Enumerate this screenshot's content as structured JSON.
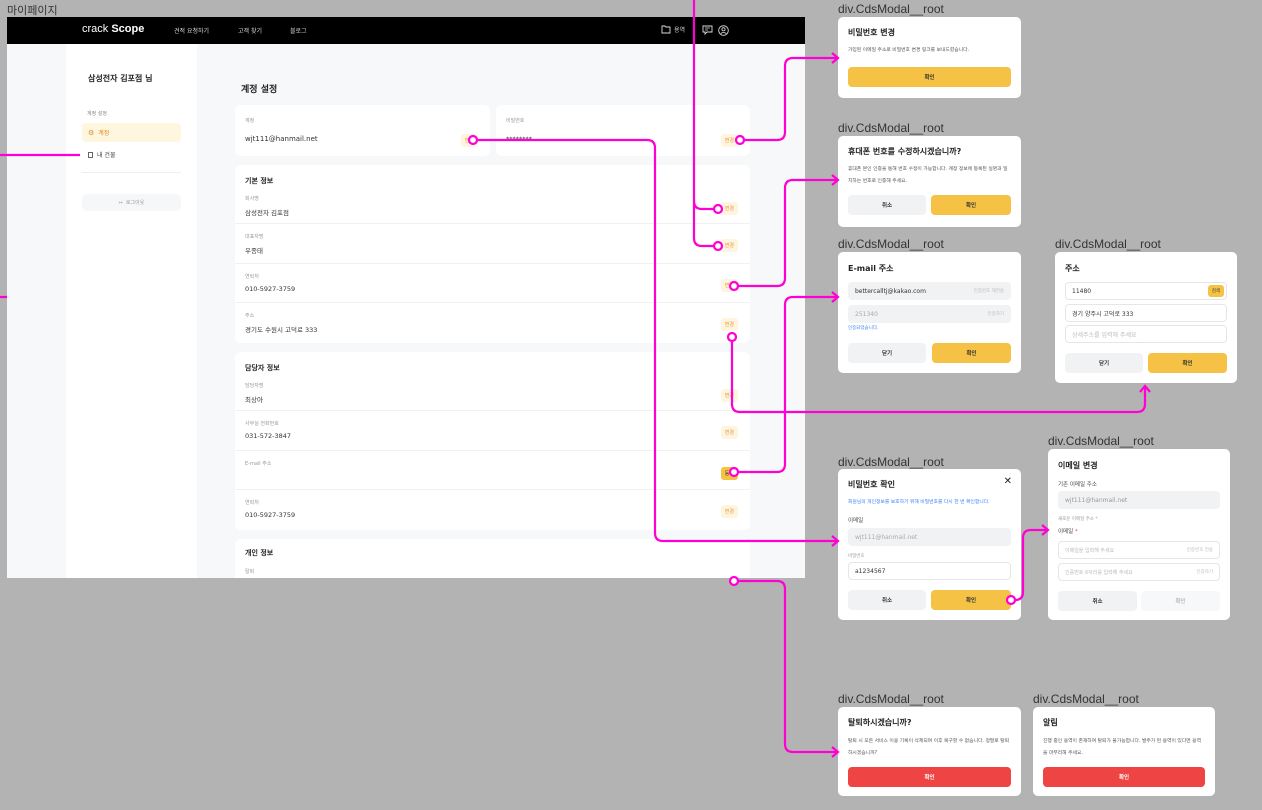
{
  "canvas": {
    "frame_label": "마이페이지",
    "modal_label": "div.CdsModal__root",
    "connector_color": "#ff00d4"
  },
  "header": {
    "logo_light": "crack ",
    "logo_bold": "Scope",
    "nav": [
      "견적 요청하기",
      "고객 찾기",
      "블로그"
    ],
    "orders": "용역",
    "icons": [
      "folder-icon",
      "chat-icon",
      "user-icon"
    ]
  },
  "sidebar": {
    "user": "삼성전자 김포점 님",
    "section": "계정 설정",
    "items": [
      {
        "label": "계정",
        "icon": "gear-icon",
        "active": true
      },
      {
        "label": "내 건물",
        "icon": "building-icon",
        "active": false
      }
    ],
    "logout": "로그아웃"
  },
  "main": {
    "title": "계정 설정",
    "account": {
      "label": "계정",
      "value": "wjt111@hanmail.net",
      "button": "변경"
    },
    "password": {
      "label": "비밀번호",
      "value": "********",
      "button": "변경"
    },
    "basic": {
      "title": "기본 정보",
      "rows": [
        {
          "label": "회사명",
          "value": "삼성전자 김포점",
          "button": "변경"
        },
        {
          "label": "대표자명",
          "value": "우종태",
          "button": "변경"
        },
        {
          "label": "연락처",
          "value": "010-5927-3759",
          "button": "변경"
        },
        {
          "label": "주소",
          "value": "경기도 수원시 고덕로 333",
          "button": "변경"
        }
      ]
    },
    "manager": {
      "title": "담당자 정보",
      "rows": [
        {
          "label": "담당자명",
          "value": "최상아",
          "button": "변경"
        },
        {
          "label": "사무실 전화번호",
          "value": "031-572-3847",
          "button": "변경"
        },
        {
          "label": "E-mail 주소",
          "value": "",
          "button": "등록"
        },
        {
          "label": "연락처",
          "value": "010-5927-3759",
          "button": "변경"
        }
      ]
    },
    "personal": {
      "title": "개인 정보",
      "rows": [
        {
          "label": "탈퇴"
        }
      ]
    }
  },
  "modals": {
    "pw_change": {
      "title": "비밀번호 변경",
      "text": "가입된 이메일 주소로 비밀번호 변경 링크를 보내드렸습니다.",
      "confirm": "확인"
    },
    "phone": {
      "title": "휴대폰 번호를 수정하시겠습니까?",
      "text": "휴대폰 본인 인증을 통해 번호 수정이 가능합니다. 계정 정보에 등록된 실명과 일치하는 번호로 인증해 주세요.",
      "cancel": "취소",
      "confirm": "확인"
    },
    "email": {
      "title": "E-mail 주소",
      "email_value": "bettercalltj@kakao.com",
      "send_label": "인증번호 재전송",
      "code_value": "251340",
      "verify_label": "인증하기",
      "verified": "인증되었습니다.",
      "close": "닫기",
      "confirm": "확인"
    },
    "address": {
      "title": "주소",
      "zip": "11480",
      "search": "검색",
      "address": "경기 양주시 고덕로 333",
      "detail_placeholder": "상세주소를 입력해 주세요",
      "close": "닫기",
      "confirm": "확인"
    },
    "pw_check": {
      "title": "비밀번호 확인",
      "text": "회원님의 개인정보를 보호하기 위해 비밀번호를 다시 한 번 확인합니다.",
      "email_label": "이메일",
      "email_value": "wjt111@hanmail.net",
      "pw_label": "비밀번호",
      "pw_value": "a1234567",
      "cancel": "취소",
      "confirm": "확인"
    },
    "email_change": {
      "title": "이메일 변경",
      "current_label": "기존 이메일 주소",
      "current_value": "wjt111@hanmail.net",
      "new_label": "새로운 이메일 주소 *",
      "email_label": "이메일",
      "required": "*",
      "email_placeholder": "이메일을 입력해 주세요",
      "send_label": "인증번호 전송",
      "code_placeholder": "인증번호 6자리를 입력해 주세요",
      "verify_label": "인증하기",
      "cancel": "취소",
      "confirm": "확인"
    },
    "withdraw": {
      "title": "탈퇴하시겠습니까?",
      "text": "탈퇴 시 모든 서비스 이용 기록이 삭제되며 이후 복구할 수 없습니다. 정말로 탈퇴하시겠습니까?",
      "confirm": "확인"
    },
    "notice": {
      "title": "알림",
      "text": "진행 중인 용역이 존재하여 탈퇴가 불가능합니다. 발주가 된 용역이 있다면 용역을 마무리해 주세요.",
      "confirm": "확인"
    }
  }
}
